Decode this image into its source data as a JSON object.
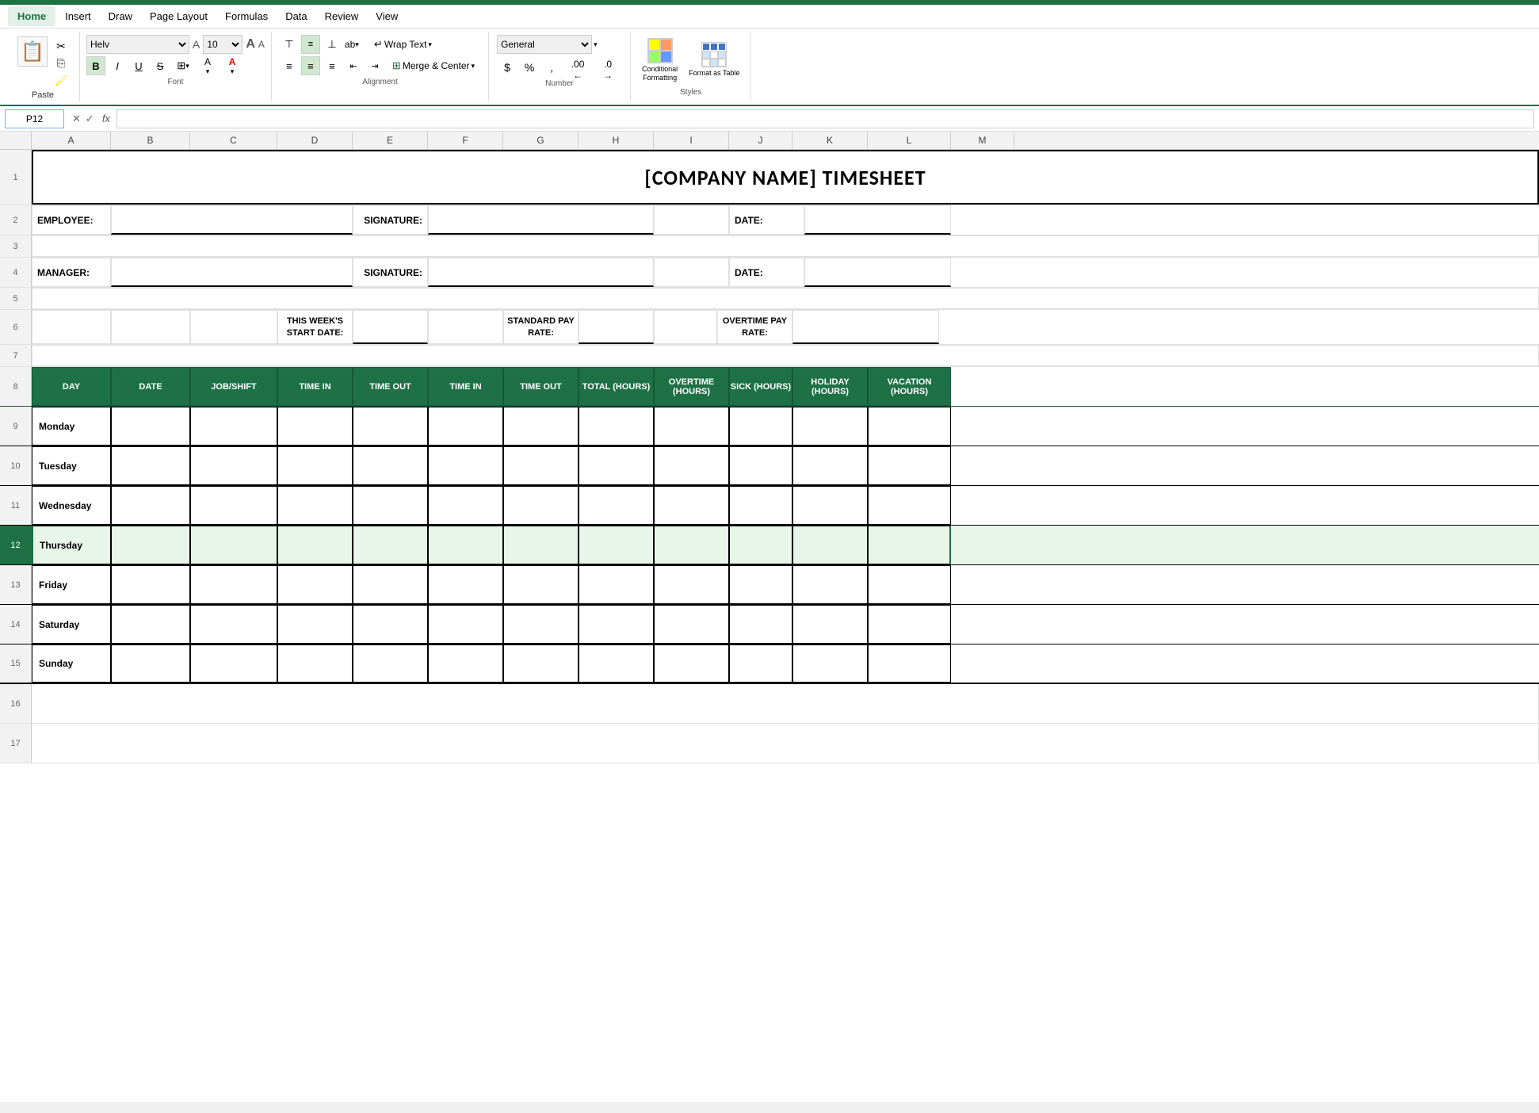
{
  "topbar": {
    "color": "#1e7145"
  },
  "menu": {
    "items": [
      "Home",
      "Insert",
      "Draw",
      "Page Layout",
      "Formulas",
      "Data",
      "Review",
      "View"
    ],
    "active": "Home"
  },
  "ribbon": {
    "paste_label": "Paste",
    "font": {
      "name": "Helv",
      "size": "10",
      "bold": "B",
      "italic": "I",
      "underline": "U"
    },
    "wrap_text": "Wrap Text",
    "merge_center": "Merge & Center",
    "number_format": "General",
    "conditional_formatting": "Conditional Formatting",
    "format_as_table": "Format as Table"
  },
  "formula_bar": {
    "cell_ref": "P12",
    "formula": ""
  },
  "spreadsheet": {
    "title": "[COMPANY NAME] TIMESHEET",
    "fields": {
      "employee_label": "EMPLOYEE:",
      "signature_label": "SIGNATURE:",
      "date_label": "DATE:",
      "manager_label": "MANAGER:",
      "this_weeks_start_date": "THIS WEEK'S START DATE:",
      "standard_pay_rate": "STANDARD PAY RATE:",
      "overtime_pay_rate": "OVERTIME PAY RATE:"
    },
    "headers": {
      "day": "DAY",
      "date": "DATE",
      "job_shift": "JOB/SHIFT",
      "time_in_1": "TIME IN",
      "time_out_1": "TIME OUT",
      "time_in_2": "TIME IN",
      "time_out_2": "TIME OUT",
      "total_hours": "TOTAL (HOURS)",
      "overtime_hours": "OVERTIME (HOURS)",
      "sick_hours": "SICK (HOURS)",
      "holiday_hours": "HOLIDAY (HOURS)",
      "vacation_hours": "VACATION (HOURS)"
    },
    "days": [
      "Monday",
      "Tuesday",
      "Wednesday",
      "Thursday",
      "Friday",
      "Saturday",
      "Sunday"
    ],
    "column_letters": [
      "A",
      "B",
      "C",
      "D",
      "E",
      "F",
      "G",
      "H",
      "I",
      "J",
      "K",
      "L",
      "M"
    ],
    "row_numbers": [
      "",
      "1",
      "2",
      "3",
      "4",
      "5",
      "6",
      "7",
      "8",
      "9",
      "10",
      "11",
      "12",
      "13",
      "14",
      "15",
      "16"
    ]
  }
}
